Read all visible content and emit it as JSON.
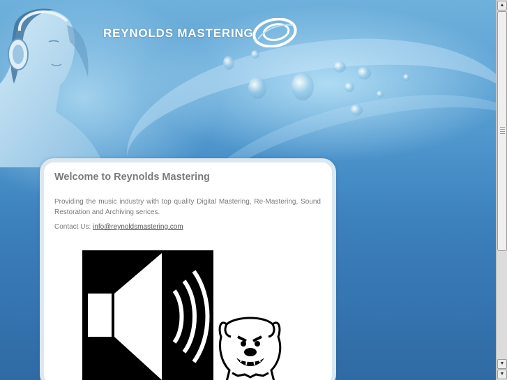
{
  "header": {
    "logo_text": "REYNOLDS MASTERING"
  },
  "main": {
    "title": "Welcome to Reynolds Mastering",
    "description": "Providing the music industry with top quality Digital Mastering, Re-Mastering, Sound Restoration and Archiving serices.",
    "contact_label": "Contact Us:",
    "contact_email": "info@reynoldsmastering.com"
  },
  "icons": {
    "speaker": "speaker-icon",
    "bulldog": "bulldog-icon",
    "logo_disc": "disc-logo-icon"
  },
  "colors": {
    "background": "#3b7fbb",
    "card": "#ffffff",
    "text": "#7a7a7a"
  }
}
